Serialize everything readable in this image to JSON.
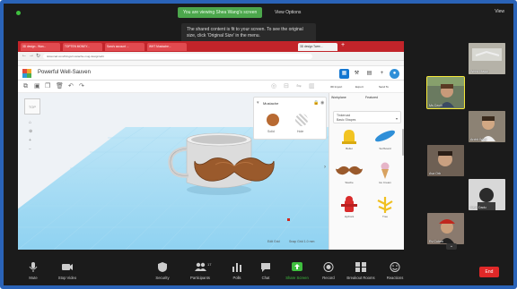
{
  "zoom": {
    "share_banner": "You are viewing Shea Wang's screen",
    "view_options": "View Options",
    "view_label": "View",
    "notice_text": "The shared content is fit to your screen. To see the original size, click 'Original Size' in the menu.",
    "end_label": "End",
    "toolbar": [
      {
        "label": "Mute",
        "icon": "microphone-icon"
      },
      {
        "label": "Stop Video",
        "icon": "video-camera-icon"
      },
      {
        "label": "Security",
        "icon": "shield-icon"
      },
      {
        "label": "Participants",
        "icon": "participants-icon",
        "count": "17"
      },
      {
        "label": "Polls",
        "icon": "bar-chart-icon"
      },
      {
        "label": "Chat",
        "icon": "chat-bubble-icon"
      },
      {
        "label": "Share Screen",
        "icon": "share-screen-icon"
      },
      {
        "label": "Record",
        "icon": "record-icon"
      },
      {
        "label": "Breakout Rooms",
        "icon": "breakout-rooms-icon"
      },
      {
        "label": "Reactions",
        "icon": "smiley-icon"
      }
    ]
  },
  "participants": [
    {
      "name": "Wrthk Maggi",
      "bg": "#a9a69c"
    },
    {
      "name": "Ms Cecili",
      "bg": "#5d6e5a",
      "active": true
    },
    {
      "name": "Archit Wagl",
      "bg": "#7b6f63"
    },
    {
      "name": "Ava Orb",
      "bg": "#6a5a52"
    },
    {
      "name": "Kavit Dadu",
      "bg": "#4a4d55"
    },
    {
      "name": "Rv Cohen",
      "bg": "#7a6c62"
    }
  ],
  "browser": {
    "tabs": [
      "3D design - Wan...",
      "TOPTEN MONEY...",
      "Sara's account ...",
      "WHT Mustache...",
      "3D design Twee..."
    ],
    "url": "tinkercad.com/things/mustache-mug-design/edit"
  },
  "tinkercad": {
    "design_title": "Powerful Well-Sauven",
    "right_labels": [
      "3D Import",
      "Export",
      "Send To"
    ],
    "panel_title": "Workplane",
    "panel_search": "Tinkercad",
    "library_labels": [
      "Basic Shapes",
      "Featured"
    ],
    "shapes_panel_title": "Mustache",
    "shape_buttons": [
      "Solid",
      "Hole"
    ],
    "shapes": [
      {
        "label": "Bullet",
        "color": "#f2c422",
        "kind": "bell"
      },
      {
        "label": "Surfboard",
        "color": "#2f8fd8",
        "kind": "board"
      },
      {
        "label": "Stache",
        "color": "#9a5a2c",
        "kind": "stache"
      },
      {
        "label": "Ice Cream",
        "color": "#e6b5c8",
        "kind": "icecream"
      },
      {
        "label": "Hydrant",
        "color": "#d92b2b",
        "kind": "hydrant"
      },
      {
        "label": "Tree",
        "color": "#f0c020",
        "kind": "tree"
      }
    ],
    "grid_labels": [
      "Edit Grid",
      "Snap Grid 1.0 mm"
    ]
  },
  "colors": {
    "frame_border": "#2a63b8",
    "share_green": "#4ca74c",
    "chrome_red": "#c2242a",
    "tinkercad_blue": "#1477d1",
    "workplane_blue": "#8fd2f1",
    "end_red": "#e02828"
  }
}
